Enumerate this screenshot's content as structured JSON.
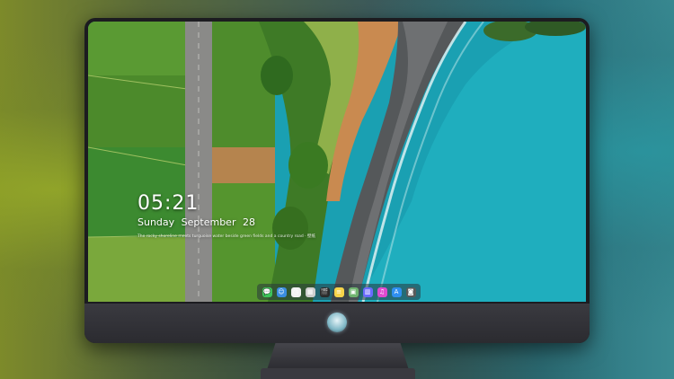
{
  "lockscreen": {
    "time": "05:21",
    "weekday": "Sunday",
    "month": "September",
    "day": "28",
    "note": "The rocky shoreline meets turquoise water beside green fields and a country road · 壁纸"
  },
  "dock": {
    "apps": [
      {
        "name": "messages-icon",
        "color": "#3cc35a",
        "glyph": "💬"
      },
      {
        "name": "finder-icon",
        "color": "#3a8de0",
        "glyph": "☺"
      },
      {
        "name": "clock-icon",
        "color": "#f2f2f2",
        "glyph": "◷"
      },
      {
        "name": "movie-icon",
        "color": "#cfcfcf",
        "glyph": "▦"
      },
      {
        "name": "clapper-icon",
        "color": "#2a2a2a",
        "glyph": "🎬"
      },
      {
        "name": "notes-icon",
        "color": "#f6d44a",
        "glyph": "≡"
      },
      {
        "name": "preview-icon",
        "color": "#6fb36f",
        "glyph": "▣"
      },
      {
        "name": "calendar-icon",
        "color": "#6a6aff",
        "glyph": "▥"
      },
      {
        "name": "itunes-icon",
        "color": "#e04bd0",
        "glyph": "♫"
      },
      {
        "name": "appstore-icon",
        "color": "#2f8ff0",
        "glyph": "A"
      },
      {
        "name": "camera-icon",
        "color": "#5a5a5a",
        "glyph": "◙"
      }
    ]
  }
}
